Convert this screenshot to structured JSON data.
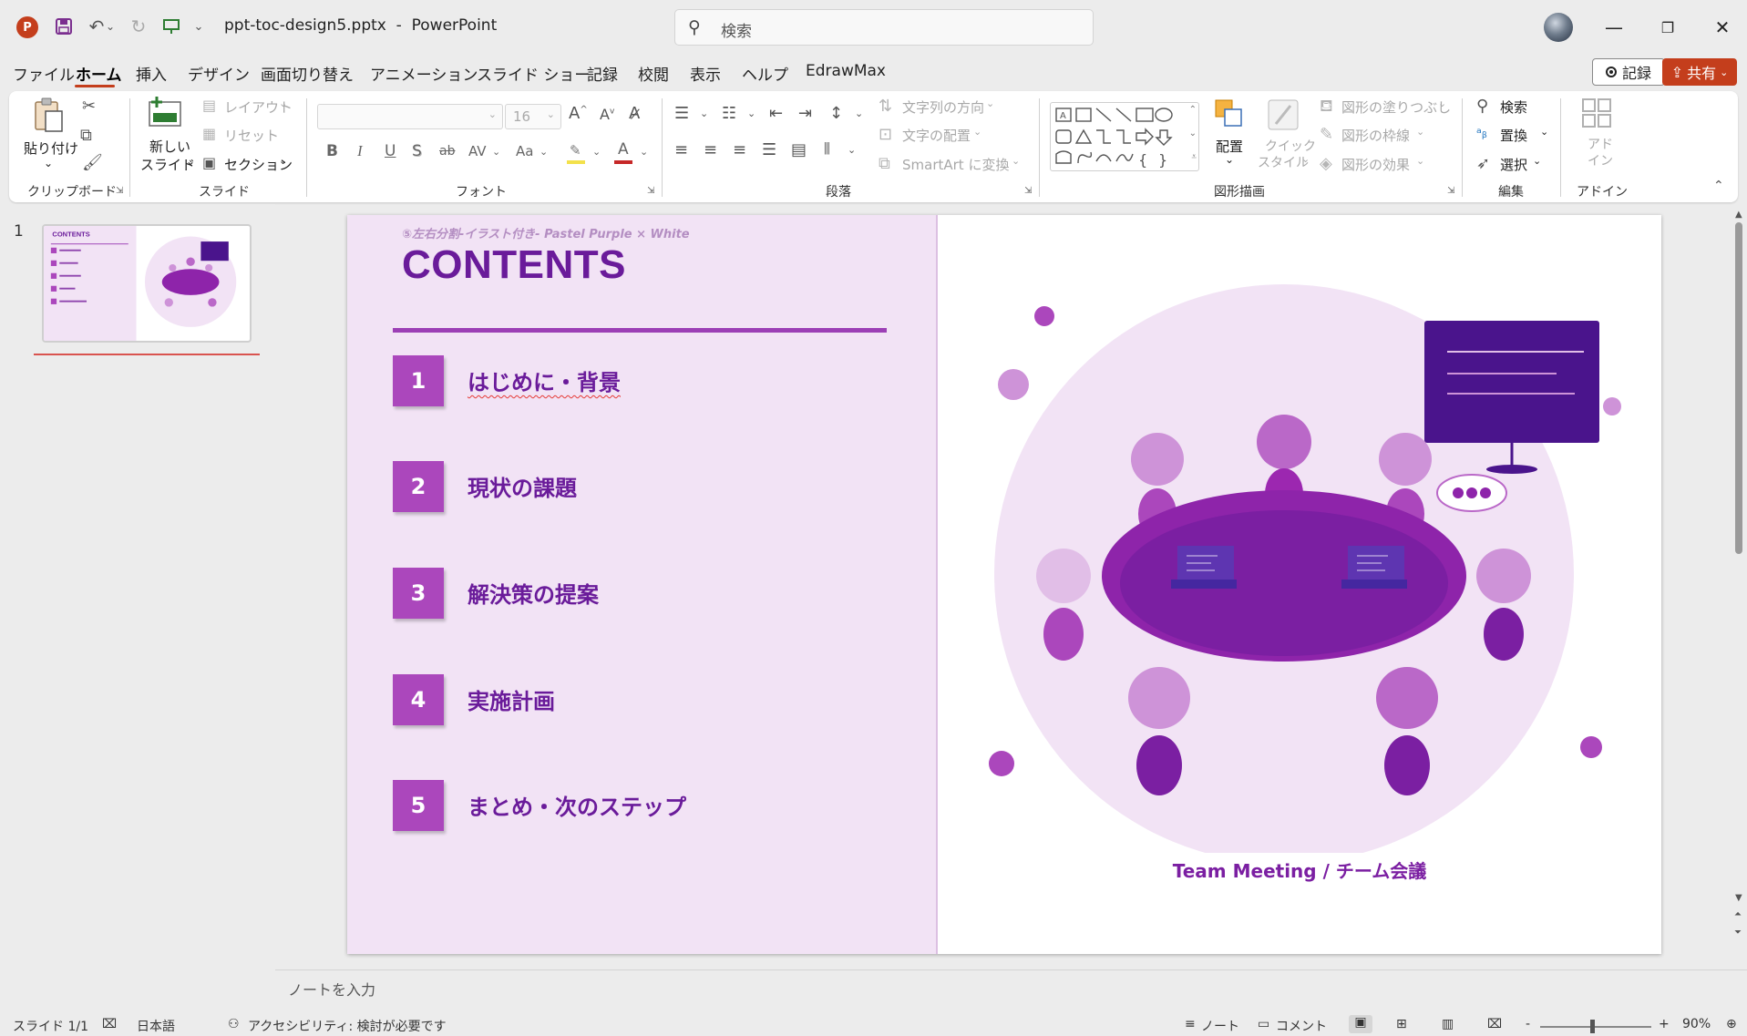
{
  "titlebar": {
    "filename": "ppt-toc-design5.pptx",
    "separator": "-",
    "app_name": "PowerPoint",
    "search_placeholder": "検索"
  },
  "menu": {
    "tabs": [
      "ファイル",
      "ホーム",
      "挿入",
      "デザイン",
      "画面切り替え",
      "アニメーション",
      "スライド ショー",
      "記録",
      "校閲",
      "表示",
      "ヘルプ",
      "EdrawMax"
    ],
    "active_tab": "ホーム",
    "record_label": "記録",
    "share_label": "共有"
  },
  "ribbon": {
    "clipboard": {
      "paste": "貼り付け",
      "label": "クリップボード"
    },
    "slides": {
      "new_slide_1": "新しい",
      "new_slide_2": "スライド",
      "layout": "レイアウト",
      "reset": "リセット",
      "section": "セクション",
      "label": "スライド"
    },
    "font": {
      "size_placeholder": "16",
      "label": "フォント",
      "bold": "B",
      "italic": "I",
      "underline": "U",
      "shadow": "S",
      "strike": "ab",
      "spacing": "AV",
      "case": "Aa"
    },
    "paragraph": {
      "text_direction": "文字列の方向",
      "align_text": "文字の配置",
      "smartart": "SmartArt に変換",
      "label": "段落"
    },
    "drawing": {
      "arrange": "配置",
      "quick_styles_1": "クイック",
      "quick_styles_2": "スタイル",
      "fill": "図形の塗りつぶし",
      "outline": "図形の枠線",
      "effects": "図形の効果",
      "label": "図形描画"
    },
    "editing": {
      "find": "検索",
      "replace": "置換",
      "select": "選択",
      "label": "編集"
    },
    "addins": {
      "addin_1": "アド",
      "addin_2": "イン",
      "label": "アドイン"
    }
  },
  "thumbnails": {
    "slide_number": "1"
  },
  "slide": {
    "subtitle": "⑤左右分割-イラスト付き-  Pastel Purple × White",
    "title": "CONTENTS",
    "items": [
      {
        "num": "1",
        "label": "はじめに・背景"
      },
      {
        "num": "2",
        "label": "現状の課題"
      },
      {
        "num": "3",
        "label": "解決策の提案"
      },
      {
        "num": "4",
        "label": "実施計画"
      },
      {
        "num": "5",
        "label": "まとめ・次のステップ"
      }
    ],
    "caption": "Team Meeting / チーム会議"
  },
  "notes": {
    "placeholder": "ノートを入力"
  },
  "status": {
    "slide_counter": "スライド 1/1",
    "language": "日本語",
    "accessibility": "アクセシビリティ: 検討が必要です",
    "notes": "ノート",
    "comments": "コメント",
    "zoom_minus": "-",
    "zoom_plus": "+",
    "zoom": "90%"
  },
  "colors": {
    "accent": "#c43e1c",
    "slide_purple": "#6a1b9a",
    "box_purple": "#ab47bc",
    "panel_bg": "#f2e3f5"
  },
  "icons": [
    "powerpoint-logo-icon",
    "save-icon",
    "undo-icon",
    "redo-icon",
    "present-icon",
    "customize-icon",
    "search-icon",
    "minimize-icon",
    "restore-icon",
    "close-icon"
  ]
}
